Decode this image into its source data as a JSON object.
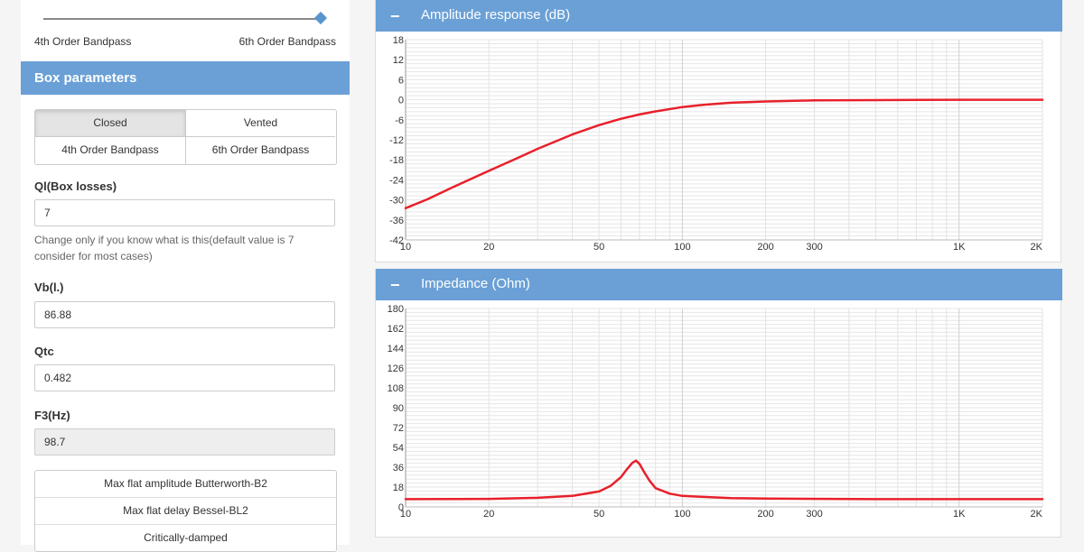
{
  "slider": {
    "left_label": "4th Order Bandpass",
    "right_label": "6th Order Bandpass"
  },
  "box_params": {
    "title": "Box parameters",
    "types": [
      "Closed",
      "Vented",
      "4th Order Bandpass",
      "6th Order Bandpass"
    ],
    "active_type": "Closed"
  },
  "fields": {
    "ql": {
      "label": "Ql(Box losses)",
      "value": "7",
      "help": "Change only if you know what is this(default value is 7 consider for most cases)"
    },
    "vb": {
      "label": "Vb(l.)",
      "value": "86.88"
    },
    "qtc": {
      "label": "Qtc",
      "value": "0.482"
    },
    "f3": {
      "label": "F3(Hz)",
      "value": "98.7"
    }
  },
  "alignments": [
    "Max flat amplitude Butterworth-B2",
    "Max flat delay Bessel-BL2",
    "Critically-damped"
  ],
  "panels": {
    "amplitude": {
      "collapse": "−",
      "title": "Amplitude response (dB)"
    },
    "impedance": {
      "collapse": "−",
      "title": "Impedance (Ohm)"
    }
  },
  "colors": {
    "accent": "#6aa0d6",
    "curve": "#e8202a"
  },
  "chart_data": [
    {
      "type": "line",
      "title": "Amplitude response (dB)",
      "x_scale": "log",
      "xlim": [
        10,
        2000
      ],
      "ylim": [
        -42,
        18
      ],
      "x_ticks": [
        10,
        20,
        50,
        100,
        200,
        300,
        1000,
        2000
      ],
      "x_tick_labels": [
        "10",
        "20",
        "50",
        "100",
        "200",
        "300",
        "1K",
        "2K"
      ],
      "y_ticks": [
        18,
        12,
        6,
        0,
        -6,
        -12,
        -18,
        -24,
        -30,
        -36,
        -42
      ],
      "grid": true,
      "series": [
        {
          "x": [
            10,
            12,
            15,
            20,
            25,
            30,
            40,
            50,
            60,
            70,
            80,
            100,
            120,
            150,
            200,
            300,
            500,
            1000,
            2000
          ],
          "y": [
            -32.5,
            -29.8,
            -26.0,
            -21.3,
            -17.7,
            -14.7,
            -10.4,
            -7.6,
            -5.7,
            -4.4,
            -3.5,
            -2.2,
            -1.5,
            -0.9,
            -0.5,
            -0.2,
            -0.1,
            0,
            0
          ]
        }
      ]
    },
    {
      "type": "line",
      "title": "Impedance (Ohm)",
      "x_scale": "log",
      "xlim": [
        10,
        2000
      ],
      "ylim": [
        0,
        180
      ],
      "x_ticks": [
        10,
        20,
        50,
        100,
        200,
        300,
        1000,
        2000
      ],
      "x_tick_labels": [
        "10",
        "20",
        "50",
        "100",
        "200",
        "300",
        "1K",
        "2K"
      ],
      "y_ticks": [
        180,
        162,
        144,
        126,
        108,
        90,
        72,
        54,
        36,
        18,
        0
      ],
      "grid": true,
      "series": [
        {
          "x": [
            10,
            20,
            30,
            40,
            50,
            55,
            60,
            63,
            66,
            68,
            70,
            73,
            76,
            80,
            90,
            100,
            150,
            200,
            500,
            1000,
            2000
          ],
          "y": [
            7,
            7.3,
            8.3,
            10,
            14,
            19,
            27,
            34,
            40,
            42,
            39,
            31,
            24,
            17,
            12,
            10,
            8,
            7.5,
            7,
            7,
            7
          ]
        }
      ]
    }
  ]
}
